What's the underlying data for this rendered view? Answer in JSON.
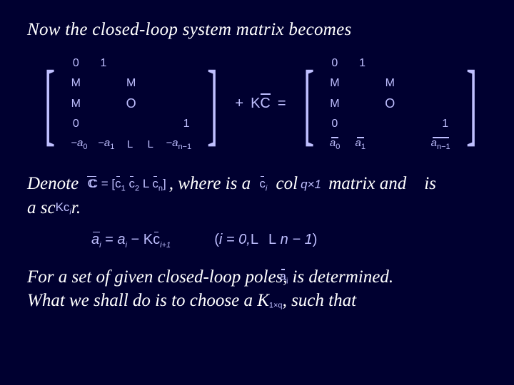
{
  "title": "Now the closed-loop system matrix becomes",
  "matrix": {
    "row1": {
      "c1": "0",
      "c2": "1"
    },
    "row2": {
      "c1": "M",
      "c2": "M"
    },
    "row3": {
      "c1": "M",
      "diag": "O"
    },
    "row4": {
      "c1": "0",
      "cn": "1"
    },
    "row5": {
      "a0": "−a",
      "s0": "0",
      "a1": "−a",
      "s1": "1",
      "L1": "L",
      "L2": "L",
      "an1": "−a",
      "sn1": "n−1"
    },
    "plus": "+",
    "kc": "KC",
    "eq": "=",
    "result_row5": {
      "a0": "a",
      "s0": "0",
      "a1": "a",
      "s1": "1",
      "an1": "a",
      "sn1": "n−1"
    }
  },
  "denote": {
    "pre": "Denote",
    "C_eq": "C = ",
    "c1": "c",
    "s1": "1",
    "c2": "c",
    "s2": "2",
    "cn": "c",
    "sn": "n",
    "mid": ", where    is a",
    "ci": "c",
    "si": "i",
    "col_word": "column matrix and    is",
    "qx1": "q×1",
    "line2_pre": "a scalar.",
    "Kc": "Kc",
    "Kci_sub": "i"
  },
  "equation": {
    "lhs_a": "a",
    "lhs_sub": "i",
    "eq": " = ",
    "rhs_a": "a",
    "rhs_sub": "i",
    "minus": " − ",
    "K": "K",
    "c": "c",
    "c_sub": "i+1",
    "open": "(",
    "i_eq": "i = 0,",
    "L1": "L",
    "L2": "L",
    "nminus1": " n − 1",
    "close": ")"
  },
  "closing": {
    "line1a": "For a set of given closed-loop poles,     is determined.",
    "ai": "a",
    "ai_sub": "i",
    "line2": "What we shall do is to choose a K",
    "k_sub": "1×q",
    "line2b": ", such that"
  }
}
